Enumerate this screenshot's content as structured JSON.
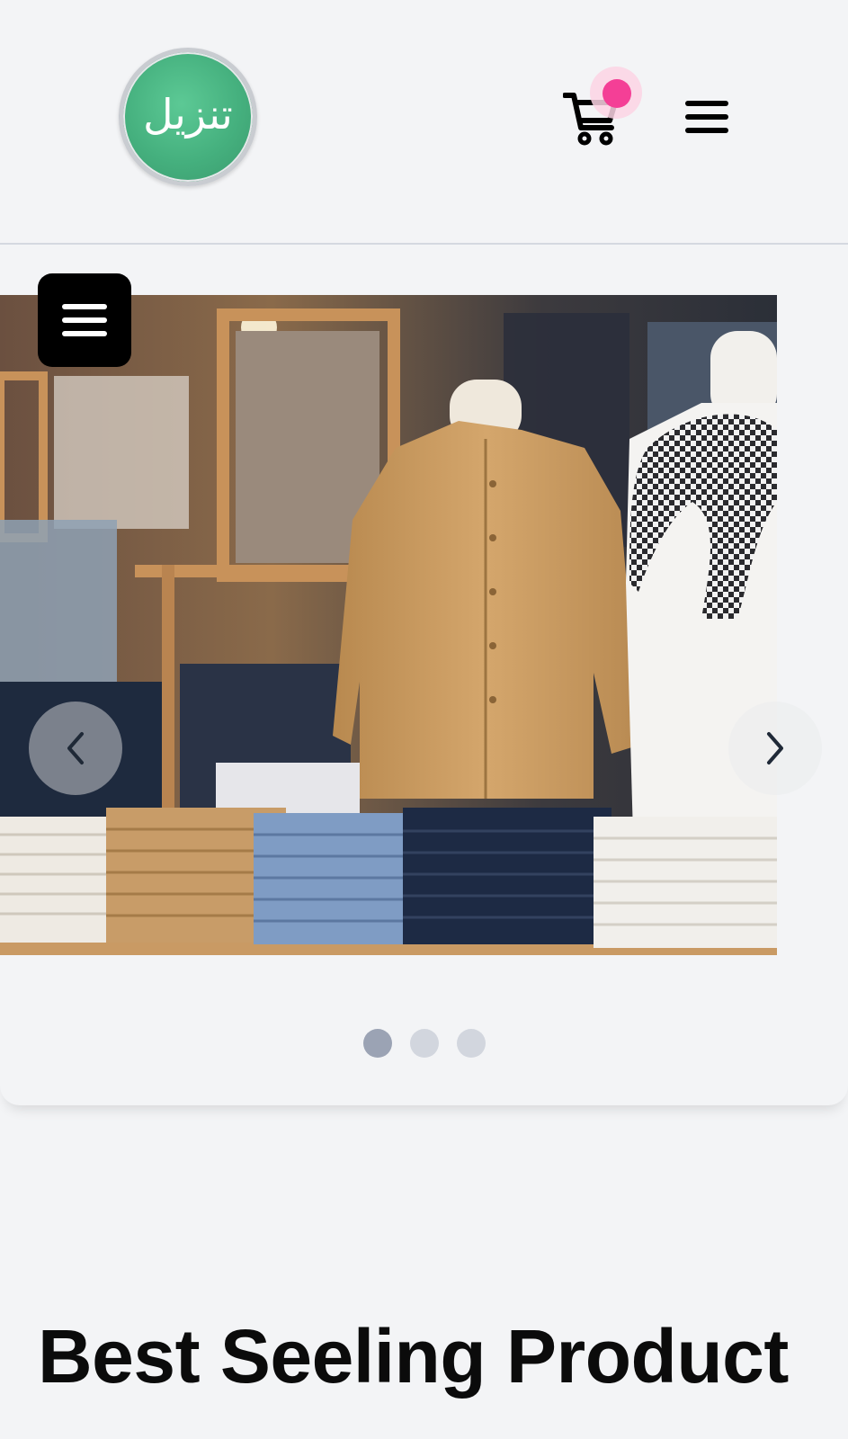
{
  "header": {
    "logo_text": "تنزيل",
    "cart_icon": "shopping-cart-icon",
    "menu_icon": "hamburger-menu-icon",
    "badge_color": "#f43f96"
  },
  "carousel": {
    "slide_image": "clothing-store-mannequin-photo",
    "side_menu_icon": "hamburger-menu-icon",
    "prev_icon": "chevron-left-icon",
    "next_icon": "chevron-right-icon",
    "slide_count": 3,
    "active_index": 0
  },
  "section": {
    "title": "Best Seeling Product"
  },
  "colors": {
    "background": "#f3f4f6",
    "logo_green": "#45b07e",
    "dot_active": "#9ba3b4",
    "dot_inactive": "#d2d6de"
  }
}
